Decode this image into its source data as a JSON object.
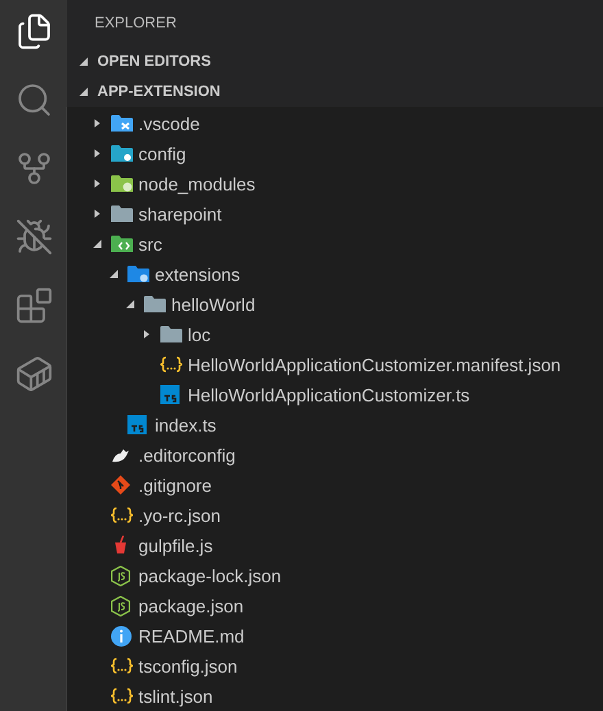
{
  "activity_bar": [
    {
      "kind": "explorer",
      "selected": true
    },
    {
      "kind": "search",
      "selected": false
    },
    {
      "kind": "source-control",
      "selected": false
    },
    {
      "kind": "debug",
      "selected": false
    },
    {
      "kind": "extensions",
      "selected": false
    },
    {
      "kind": "docker",
      "selected": false
    }
  ],
  "explorer": {
    "title": "EXPLORER",
    "sections": [
      {
        "title": "OPEN EDITORS",
        "expanded": true
      },
      {
        "title": "APP-EXTENSION",
        "expanded": true
      }
    ],
    "tree": [
      {
        "name": ".vscode",
        "kind": "folder-vscode",
        "expanded": false
      },
      {
        "name": "config",
        "kind": "folder-config",
        "expanded": false
      },
      {
        "name": "node_modules",
        "kind": "folder-node",
        "expanded": false
      },
      {
        "name": "sharepoint",
        "kind": "folder",
        "expanded": false
      },
      {
        "name": "src",
        "kind": "folder-src",
        "expanded": true,
        "children": [
          {
            "name": "extensions",
            "kind": "folder-extensions",
            "expanded": true,
            "children": [
              {
                "name": "helloWorld",
                "kind": "folder",
                "expanded": true,
                "children": [
                  {
                    "name": "loc",
                    "kind": "folder",
                    "expanded": false
                  },
                  {
                    "name": "HelloWorldApplicationCustomizer.manifest.json",
                    "kind": "json"
                  },
                  {
                    "name": "HelloWorldApplicationCustomizer.ts",
                    "kind": "ts"
                  }
                ]
              }
            ]
          },
          {
            "name": "index.ts",
            "kind": "ts"
          }
        ]
      },
      {
        "name": ".editorconfig",
        "kind": "editorconfig"
      },
      {
        "name": ".gitignore",
        "kind": "git"
      },
      {
        "name": ".yo-rc.json",
        "kind": "json"
      },
      {
        "name": "gulpfile.js",
        "kind": "gulp"
      },
      {
        "name": "package-lock.json",
        "kind": "node"
      },
      {
        "name": "package.json",
        "kind": "node"
      },
      {
        "name": "README.md",
        "kind": "info"
      },
      {
        "name": "tsconfig.json",
        "kind": "json"
      },
      {
        "name": "tslint.json",
        "kind": "json"
      }
    ]
  }
}
